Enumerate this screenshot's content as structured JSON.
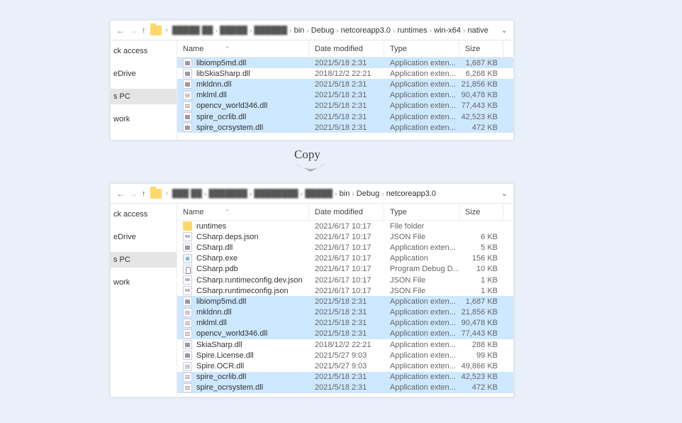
{
  "copy_label": "Copy",
  "columns": {
    "name": "Name",
    "date": "Date modified",
    "type": "Type",
    "size": "Size"
  },
  "sidebar": {
    "items": [
      "ck access",
      "eDrive",
      "s PC",
      "work"
    ],
    "selected_index": 2
  },
  "window1": {
    "breadcrumb_blur": [
      "█████ ██",
      "█████",
      "██████"
    ],
    "breadcrumb": [
      "bin",
      "Debug",
      "netcoreapp3.0",
      "runtimes",
      "win-x64",
      "native"
    ],
    "files": [
      {
        "name": "libiomp5md.dll",
        "date": "2021/5/18 2:31",
        "type": "Application exten...",
        "size": "1,687 KB",
        "icon": "dll",
        "sel": true
      },
      {
        "name": "libSkiaSharp.dll",
        "date": "2018/12/2 22:21",
        "type": "Application exten...",
        "size": "6,268 KB",
        "icon": "dll",
        "sel": false
      },
      {
        "name": "mkldnn.dll",
        "date": "2021/5/18 2:31",
        "type": "Application exten...",
        "size": "21,856 KB",
        "icon": "dll",
        "sel": true
      },
      {
        "name": "mklml.dll",
        "date": "2021/5/18 2:31",
        "type": "Application exten...",
        "size": "90,478 KB",
        "icon": "dll",
        "sel": true
      },
      {
        "name": "opencv_world346.dll",
        "date": "2021/5/18 2:31",
        "type": "Application exten...",
        "size": "77,443 KB",
        "icon": "dll",
        "sel": true
      },
      {
        "name": "spire_ocrlib.dll",
        "date": "2021/5/18 2:31",
        "type": "Application exten...",
        "size": "42,523 KB",
        "icon": "dll",
        "sel": true
      },
      {
        "name": "spire_ocrsystem.dll",
        "date": "2021/5/18 2:31",
        "type": "Application exten...",
        "size": "472 KB",
        "icon": "dll",
        "sel": true
      }
    ]
  },
  "window2": {
    "breadcrumb_blur": [
      "███ ██",
      "███████",
      "████████",
      "█████"
    ],
    "breadcrumb": [
      "bin",
      "Debug",
      "netcoreapp3.0"
    ],
    "files": [
      {
        "name": "runtimes",
        "date": "2021/6/17 10:17",
        "type": "File folder",
        "size": "",
        "icon": "folder",
        "sel": false
      },
      {
        "name": "CSharp.deps.json",
        "date": "2021/6/17 10:17",
        "type": "JSON File",
        "size": "6 KB",
        "icon": "json",
        "sel": false
      },
      {
        "name": "CSharp.dll",
        "date": "2021/6/17 10:17",
        "type": "Application exten...",
        "size": "5 KB",
        "icon": "dll",
        "sel": false
      },
      {
        "name": "CSharp.exe",
        "date": "2021/6/17 10:17",
        "type": "Application",
        "size": "156 KB",
        "icon": "exe",
        "sel": false
      },
      {
        "name": "CSharp.pdb",
        "date": "2021/6/17 10:17",
        "type": "Program Debug D...",
        "size": "10 KB",
        "icon": "pdb",
        "sel": false
      },
      {
        "name": "CSharp.runtimeconfig.dev.json",
        "date": "2021/6/17 10:17",
        "type": "JSON File",
        "size": "1 KB",
        "icon": "json",
        "sel": false
      },
      {
        "name": "CSharp.runtimeconfig.json",
        "date": "2021/6/17 10:17",
        "type": "JSON File",
        "size": "1 KB",
        "icon": "json",
        "sel": false
      },
      {
        "name": "libiomp5md.dll",
        "date": "2021/5/18 2:31",
        "type": "Application exten...",
        "size": "1,687 KB",
        "icon": "dll",
        "sel": true
      },
      {
        "name": "mkldnn.dll",
        "date": "2021/5/18 2:31",
        "type": "Application exten...",
        "size": "21,856 KB",
        "icon": "dll",
        "sel": true
      },
      {
        "name": "mklml.dll",
        "date": "2021/5/18 2:31",
        "type": "Application exten...",
        "size": "90,478 KB",
        "icon": "dll",
        "sel": true
      },
      {
        "name": "opencv_world346.dll",
        "date": "2021/5/18 2:31",
        "type": "Application exten...",
        "size": "77,443 KB",
        "icon": "dll",
        "sel": true
      },
      {
        "name": "SkiaSharp.dll",
        "date": "2018/12/2 22:21",
        "type": "Application exten...",
        "size": "288 KB",
        "icon": "dll",
        "sel": false
      },
      {
        "name": "Spire.License.dll",
        "date": "2021/5/27 9:03",
        "type": "Application exten...",
        "size": "99 KB",
        "icon": "dll",
        "sel": false
      },
      {
        "name": "Spire.OCR.dll",
        "date": "2021/5/27 9:03",
        "type": "Application exten...",
        "size": "49,866 KB",
        "icon": "dll",
        "sel": false
      },
      {
        "name": "spire_ocrlib.dll",
        "date": "2021/5/18 2:31",
        "type": "Application exten...",
        "size": "42,523 KB",
        "icon": "dll",
        "sel": true
      },
      {
        "name": "spire_ocrsystem.dll",
        "date": "2021/5/18 2:31",
        "type": "Application exten...",
        "size": "472 KB",
        "icon": "dll",
        "sel": true
      }
    ]
  }
}
